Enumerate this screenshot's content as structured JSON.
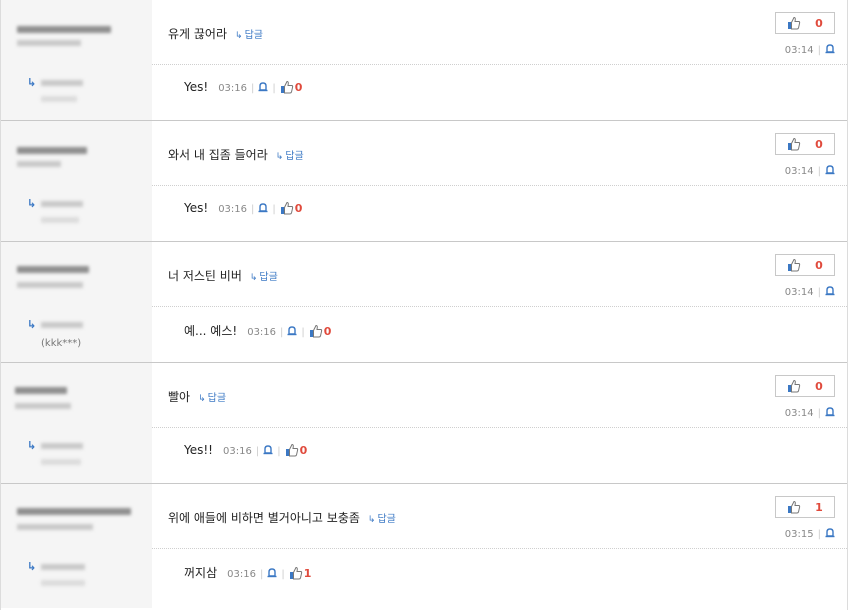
{
  "comments": [
    {
      "text": "유게 끊어라",
      "reply_label": "답글",
      "likes": "0",
      "time": "03:14",
      "reply": {
        "text": "Yes!",
        "time": "03:16",
        "likes": "0",
        "handle": ""
      }
    },
    {
      "text": "와서 내 집좀 들어라",
      "reply_label": "답글",
      "likes": "0",
      "time": "03:14",
      "reply": {
        "text": "Yes!",
        "time": "03:16",
        "likes": "0",
        "handle": ""
      }
    },
    {
      "text": "너 저스틴 비버",
      "reply_label": "답글",
      "likes": "0",
      "time": "03:14",
      "reply": {
        "text": "예... 예스!",
        "time": "03:16",
        "likes": "0",
        "handle": "(kkk***)"
      }
    },
    {
      "text": "빨아",
      "reply_label": "답글",
      "likes": "0",
      "time": "03:14",
      "reply": {
        "text": "Yes!!",
        "time": "03:16",
        "likes": "0",
        "handle": ""
      }
    },
    {
      "text": "위에 애들에 비하면 별거아니고 보충좀",
      "reply_label": "답글",
      "likes": "1",
      "time": "03:15",
      "reply": {
        "text": "꺼지삼",
        "time": "03:16",
        "likes": "1",
        "handle": ""
      }
    }
  ],
  "colors": {
    "accent": "#3b78c4",
    "like_count": "#e04a3c",
    "left_bg": "#f5f5f5"
  },
  "icons": {
    "like": "thumbs-up-icon",
    "report": "bell-icon",
    "reply": "reply-arrow-icon"
  }
}
